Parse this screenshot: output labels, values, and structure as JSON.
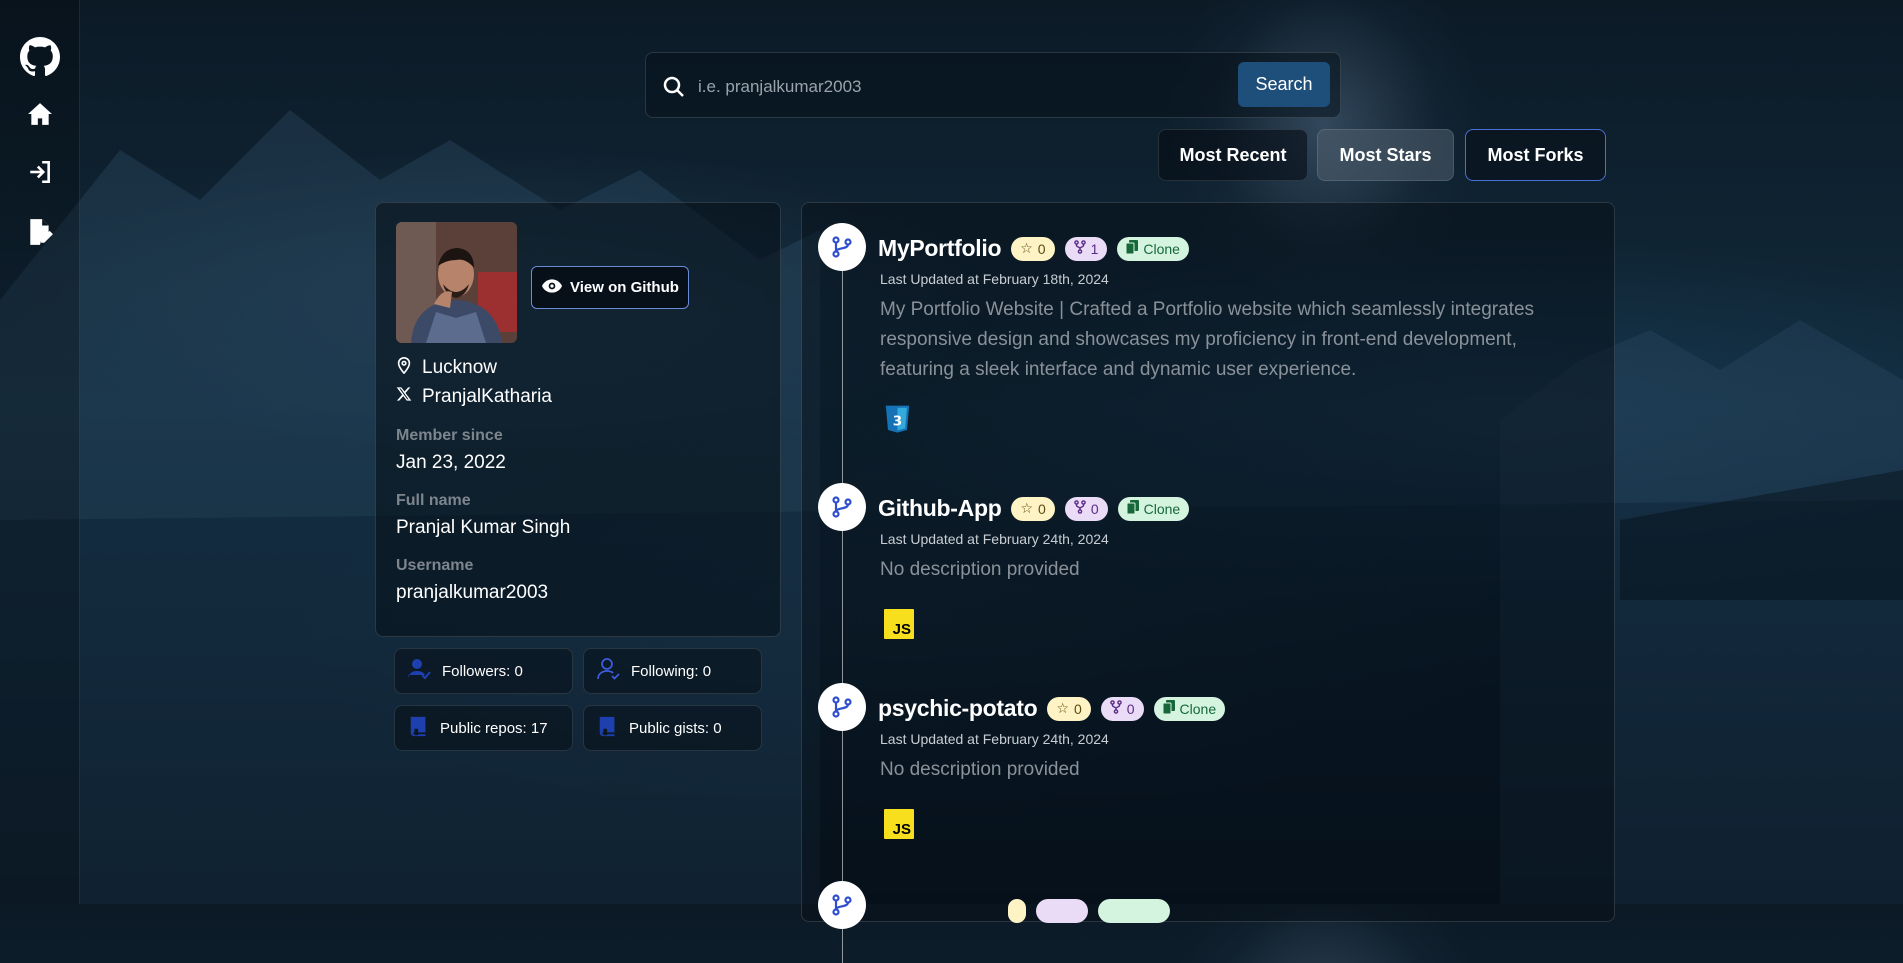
{
  "sidebar": {
    "items": [
      {
        "icon": "github-logo-icon"
      },
      {
        "icon": "home-icon"
      },
      {
        "icon": "login-icon"
      },
      {
        "icon": "signup-icon"
      }
    ]
  },
  "search": {
    "placeholder": "i.e. pranjalkumar2003",
    "value": "",
    "button_label": "Search"
  },
  "sort": {
    "options": [
      "Most Recent",
      "Most Stars",
      "Most Forks"
    ],
    "active": "Most Forks"
  },
  "profile": {
    "view_button": "View on Github",
    "location": "Lucknow",
    "twitter": "PranjalKatharia",
    "member_since_label": "Member since",
    "member_since": "Jan 23, 2022",
    "full_name_label": "Full name",
    "full_name": "Pranjal Kumar Singh",
    "username_label": "Username",
    "username": "pranjalkumar2003"
  },
  "stats": {
    "followers": "Followers: 0",
    "following": "Following: 0",
    "public_repos": "Public repos: 17",
    "public_gists": "Public gists: 0"
  },
  "repos": [
    {
      "name": "MyPortfolio",
      "stars": "0",
      "forks": "1",
      "clone_label": "Clone",
      "updated": "Last Updated at February 18th, 2024",
      "description": "My Portfolio Website | Crafted a Portfolio website which seamlessly integrates responsive design and showcases my proficiency in front-end development, featuring a sleek interface and dynamic user experience.",
      "language": "CSS"
    },
    {
      "name": "Github-App",
      "stars": "0",
      "forks": "0",
      "clone_label": "Clone",
      "updated": "Last Updated at February 24th, 2024",
      "description": "No description provided",
      "language": "JS"
    },
    {
      "name": "psychic-potato",
      "stars": "0",
      "forks": "0",
      "clone_label": "Clone",
      "updated": "Last Updated at February 24th, 2024",
      "description": "No description provided",
      "language": "JS"
    }
  ],
  "colors": {
    "accent": "#1e4f7a",
    "active_border": "#4a6fd6",
    "star_badge": "#fdf3c4",
    "fork_badge": "#eadcf7",
    "clone_badge": "#d5f4df",
    "js_yellow": "#f7df1e",
    "css_blue": "#1572b6"
  }
}
